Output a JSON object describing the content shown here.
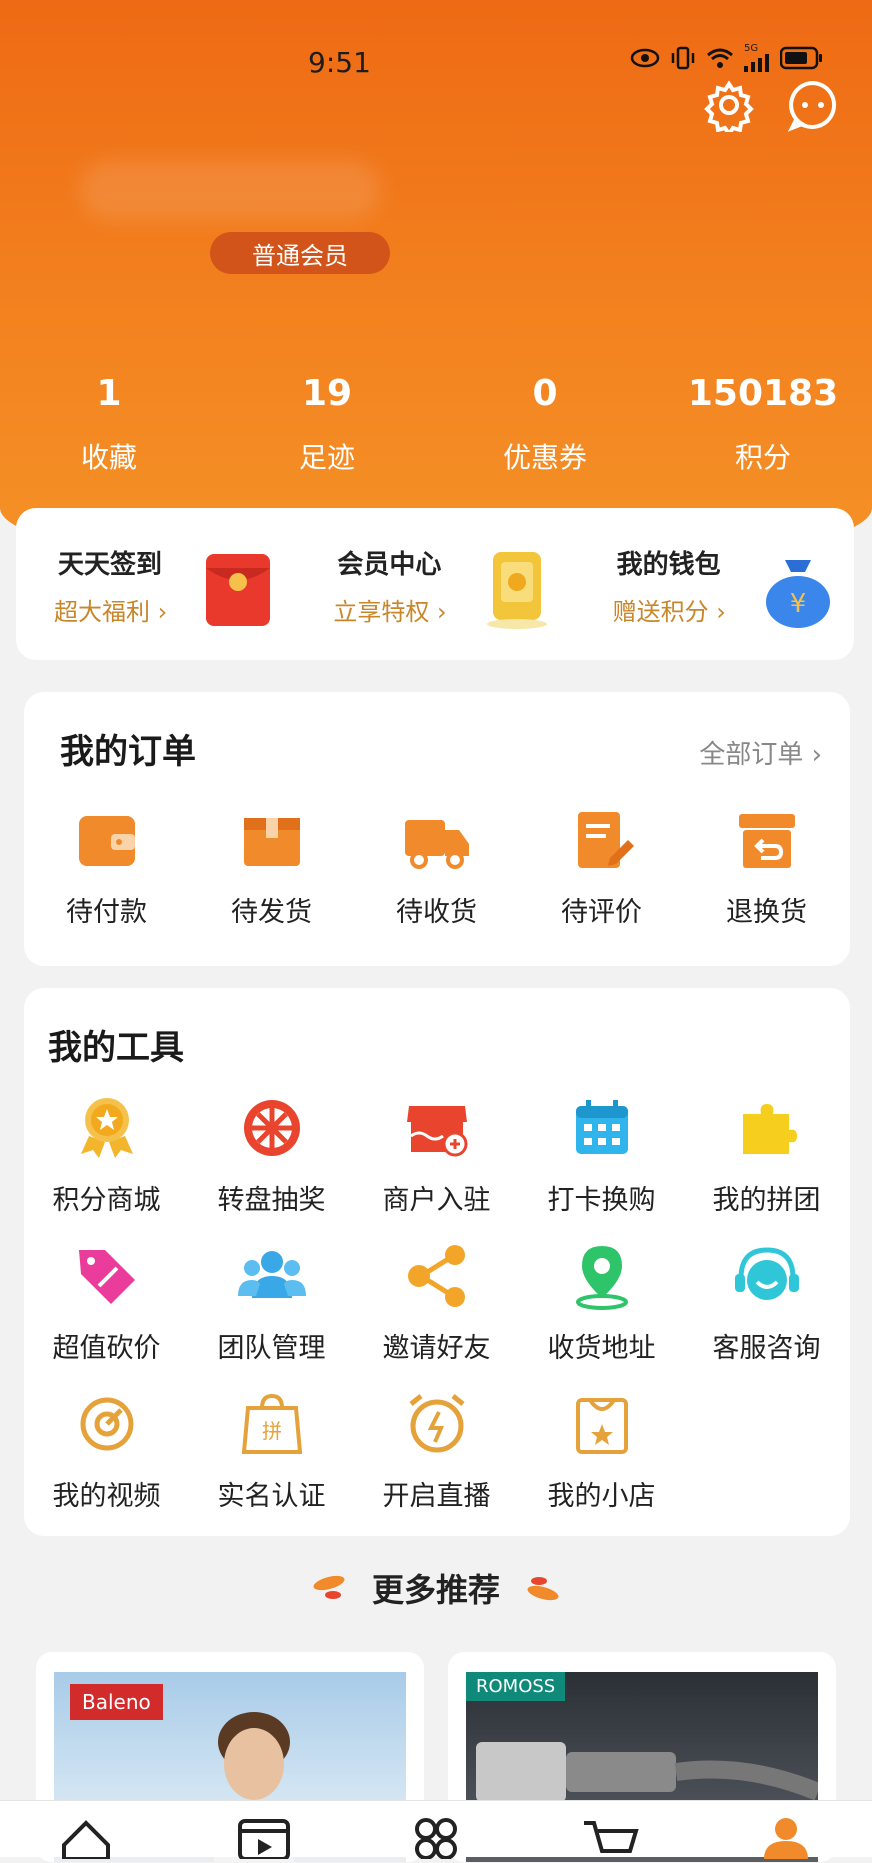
{
  "status_bar": {
    "time": "9:51",
    "network": "5G"
  },
  "profile": {
    "member_level": "普通会员"
  },
  "stats": [
    {
      "value": "1",
      "label": "收藏"
    },
    {
      "value": "19",
      "label": "足迹"
    },
    {
      "value": "0",
      "label": "优惠券"
    },
    {
      "value": "150183",
      "label": "积分"
    }
  ],
  "promos": [
    {
      "title": "天天签到",
      "sub": "超大福利",
      "icon": "red-envelope-icon"
    },
    {
      "title": "会员中心",
      "sub": "立享特权",
      "icon": "gold-card-icon"
    },
    {
      "title": "我的钱包",
      "sub": "赠送积分",
      "icon": "money-bag-icon"
    }
  ],
  "orders": {
    "title": "我的订单",
    "all_link": "全部订单",
    "items": [
      {
        "label": "待付款",
        "icon": "wallet-icon"
      },
      {
        "label": "待发货",
        "icon": "box-icon"
      },
      {
        "label": "待收货",
        "icon": "truck-icon"
      },
      {
        "label": "待评价",
        "icon": "review-icon"
      },
      {
        "label": "退换货",
        "icon": "return-icon"
      }
    ]
  },
  "tools": {
    "title": "我的工具",
    "items": [
      {
        "label": "积分商城",
        "icon": "medal-icon"
      },
      {
        "label": "转盘抽奖",
        "icon": "wheel-icon"
      },
      {
        "label": "商户入驻",
        "icon": "shop-icon"
      },
      {
        "label": "打卡换购",
        "icon": "calendar-icon"
      },
      {
        "label": "我的拼团",
        "icon": "puzzle-icon"
      },
      {
        "label": "超值砍价",
        "icon": "tag-icon"
      },
      {
        "label": "团队管理",
        "icon": "team-icon"
      },
      {
        "label": "邀请好友",
        "icon": "share-icon"
      },
      {
        "label": "收货地址",
        "icon": "location-icon"
      },
      {
        "label": "客服咨询",
        "icon": "headset-icon"
      },
      {
        "label": "我的视频",
        "icon": "video-icon"
      },
      {
        "label": "实名认证",
        "icon": "verify-bag-icon"
      },
      {
        "label": "开启直播",
        "icon": "alarm-icon"
      },
      {
        "label": "我的小店",
        "icon": "store-bag-icon"
      }
    ]
  },
  "recommend": {
    "title": "更多推荐",
    "products": [
      {
        "brand": "Baleno"
      },
      {
        "brand": "ROMOSS"
      }
    ]
  },
  "colors": {
    "header": "#ee6a14",
    "accent": "#f08a2a",
    "sub_text": "#c9862a"
  },
  "tabbar": [
    "home-icon",
    "video-icon",
    "category-icon",
    "cart-icon",
    "profile-icon"
  ]
}
